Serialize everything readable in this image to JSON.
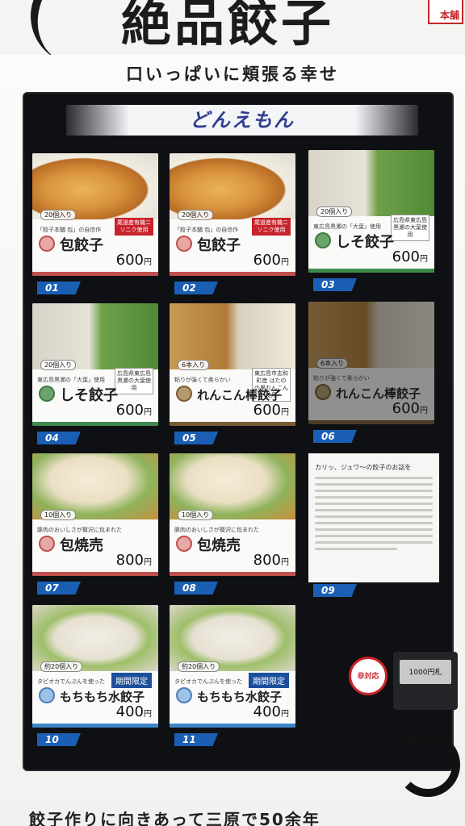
{
  "sign": {
    "title": "絶品餃子",
    "stamp": "本舗"
  },
  "machine": {
    "slogan_top": "口いっぱいに頬張る幸せ",
    "brand": "どんえもん",
    "slogan_bottom": "餃子作りに向きあって三原で50余年"
  },
  "products": [
    {
      "num": "01",
      "count": "20個入り",
      "sub": "「餃子本舗 包」の自信作",
      "name": "包餃子",
      "price": "600",
      "unit": "円",
      "tag": "尾道産有機ニソニク使用"
    },
    {
      "num": "02",
      "count": "20個入り",
      "sub": "「餃子本舗 包」の自信作",
      "name": "包餃子",
      "price": "600",
      "unit": "円",
      "tag": "尾道産有機ニソニク使用"
    },
    {
      "num": "03",
      "count": "20個入り",
      "sub": "東広島黒瀬の「大葉」使用",
      "name": "しそ餃子",
      "price": "600",
      "unit": "円",
      "tag": "広島県東広島 黒瀬の大葉使用"
    },
    {
      "num": "04",
      "count": "20個入り",
      "sub": "東広島黒瀬の「大葉」使用",
      "name": "しそ餃子",
      "price": "600",
      "unit": "円",
      "tag": "広島県東広島 黒瀬の大葉使用"
    },
    {
      "num": "05",
      "count": "6本入り",
      "sub": "粘りが強くて柔らかい",
      "name": "れんこん棒餃子",
      "price": "600",
      "unit": "円",
      "tag": "東広島市志和町産 はたのの里れんこん使用"
    },
    {
      "num": "06",
      "count": "6本入り",
      "sub": "粘りが強くて柔らかい",
      "name": "れんこん棒餃子",
      "price": "600",
      "unit": "円"
    },
    {
      "num": "07",
      "count": "10個入り",
      "sub": "豚肉のおいしさが贅沢に包まれた",
      "name": "包焼売",
      "price": "800",
      "unit": "円"
    },
    {
      "num": "08",
      "count": "10個入り",
      "sub": "豚肉のおいしさが贅沢に包まれた",
      "name": "包焼売",
      "price": "800",
      "unit": "円"
    },
    {
      "num": "09",
      "notice": "カリッ、ジュワ〜の餃子のお話を"
    },
    {
      "num": "10",
      "count": "約20個入り",
      "sub": "タピオカでんぷんを使った",
      "name": "もちもち水餃子",
      "price": "400",
      "unit": "円",
      "limited": "期間限定"
    },
    {
      "num": "11",
      "count": "約20個入り",
      "sub": "タピオカでんぷんを使った",
      "name": "もちもち水餃子",
      "price": "400",
      "unit": "円",
      "limited": "期間限定"
    }
  ],
  "bill": {
    "label": "1000円札"
  },
  "sticker": {
    "label": "非対応"
  }
}
